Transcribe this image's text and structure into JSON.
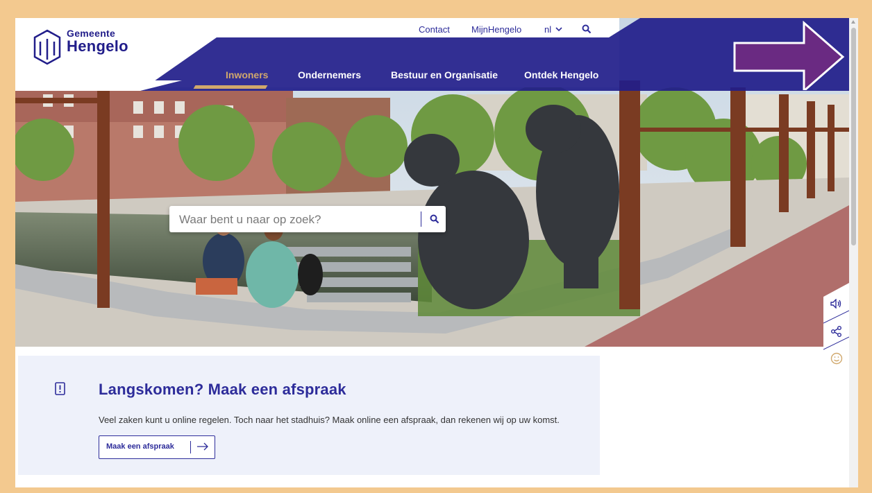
{
  "header": {
    "logo": {
      "line1": "Gemeente",
      "line2": "Hengelo"
    },
    "topnav": {
      "contact": "Contact",
      "mijn": "MijnHengelo",
      "lang": "nl"
    },
    "mainnav": [
      "Inwoners",
      "Ondernemers",
      "Bestuur en Organisatie",
      "Ontdek Hengelo"
    ],
    "active_item": "Inwoners"
  },
  "search": {
    "placeholder": "Waar bent u naar op zoek?"
  },
  "card": {
    "title": "Langskomen? Maak een afspraak",
    "text": "Veel zaken kunt u online regelen. Toch naar het stadhuis? Maak online een afspraak, dan rekenen wij op uw komst.",
    "button": "Maak een afspraak"
  },
  "side_tools": [
    "speaker-icon",
    "share-icon",
    "smiley-icon"
  ],
  "colors": {
    "brand": "#211d8a",
    "accent": "#d1a86c",
    "card_bg": "#eef1fa",
    "annotation_arrow": "#6a2a82",
    "page_border": "#f3c98f"
  }
}
